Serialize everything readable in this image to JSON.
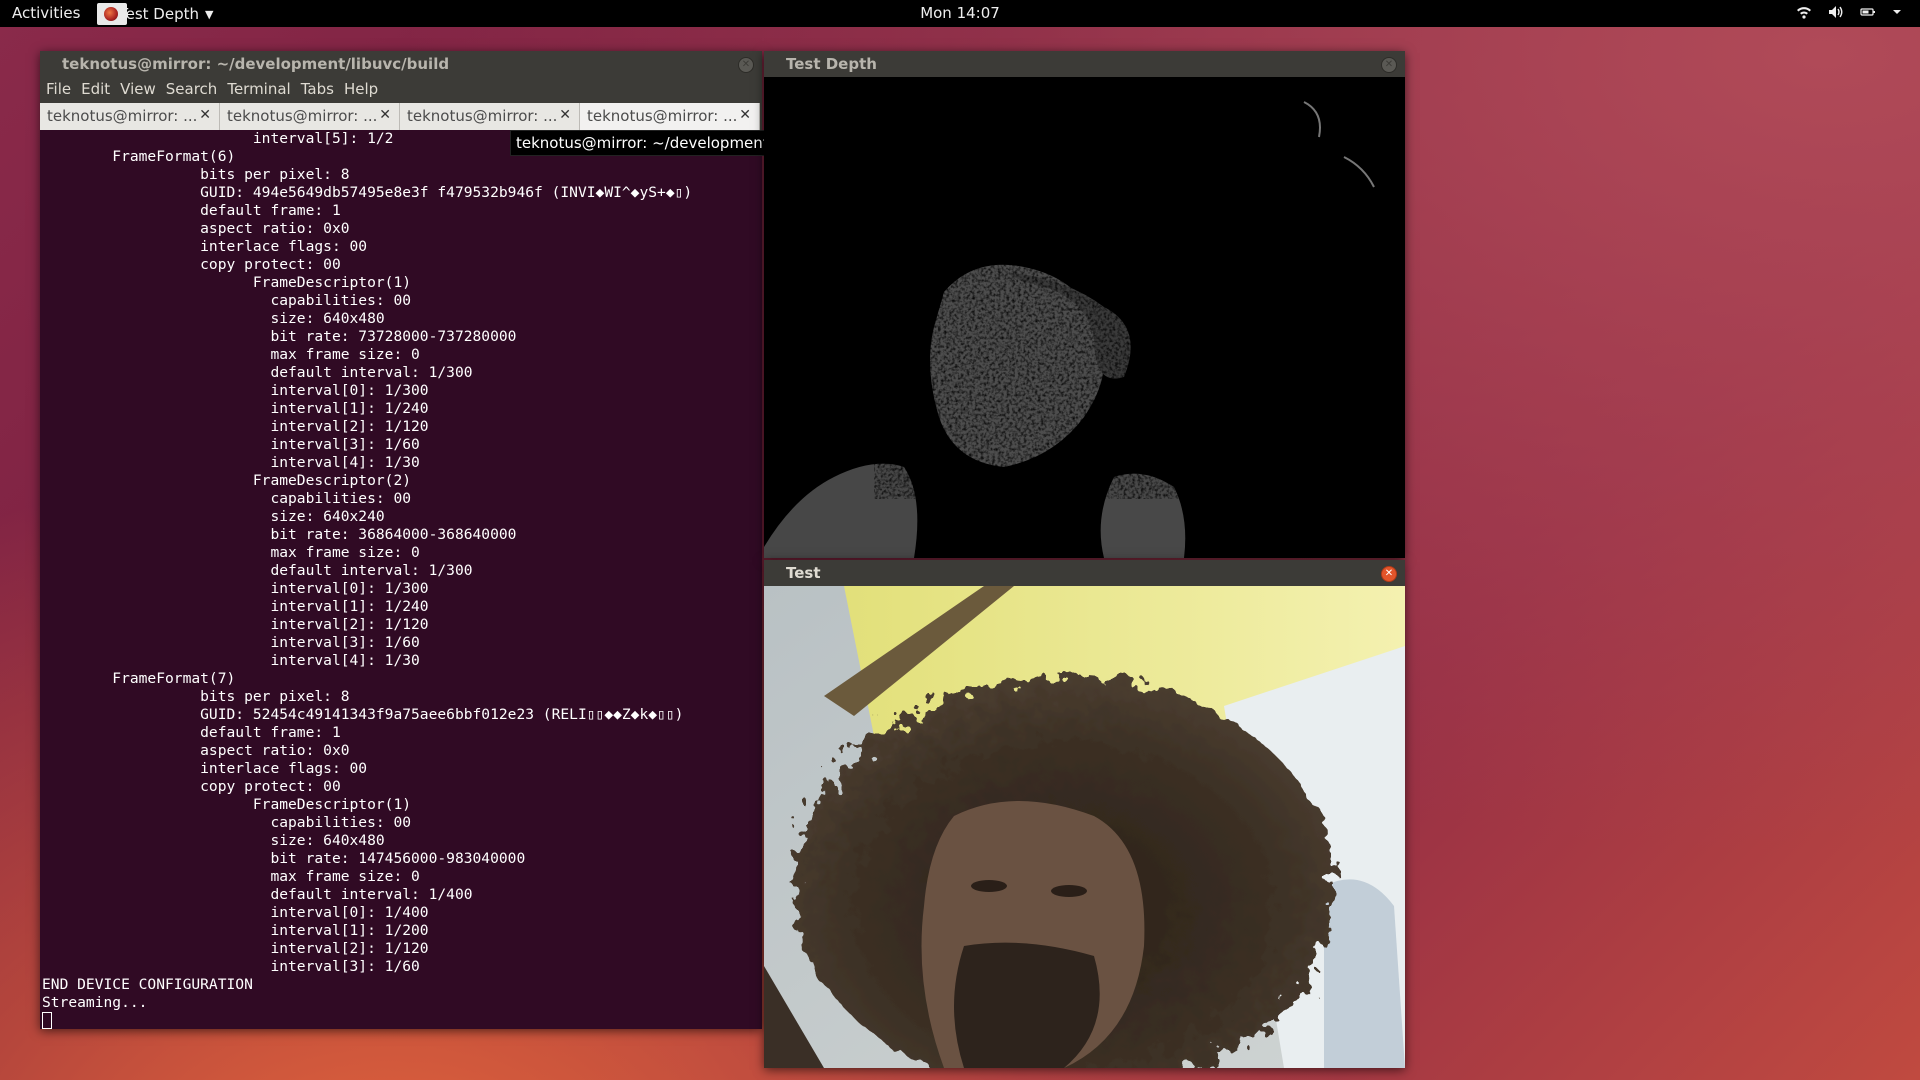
{
  "topbar": {
    "activities": "Activities",
    "app_name": "Test Depth",
    "clock": "Mon 14:07"
  },
  "terminal": {
    "title": "teknotus@mirror: ~/development/libuvc/build",
    "menu": [
      "File",
      "Edit",
      "View",
      "Search",
      "Terminal",
      "Tabs",
      "Help"
    ],
    "tabs": [
      {
        "label": "teknotus@mirror: ..."
      },
      {
        "label": "teknotus@mirror: ..."
      },
      {
        "label": "teknotus@mirror: ..."
      },
      {
        "label": "teknotus@mirror: ..."
      }
    ],
    "tooltip": "teknotus@mirror: ~/development/libuvc/build",
    "lines": [
      "                        interval[5]: 1/2",
      "        FrameFormat(6)",
      "                  bits per pixel: 8",
      "                  GUID: 494e5649db57495e8e3f f479532b946f (INVI◆WI^◆yS+◆▯)",
      "                  default frame: 1",
      "                  aspect ratio: 0x0",
      "                  interlace flags: 00",
      "                  copy protect: 00",
      "                        FrameDescriptor(1)",
      "                          capabilities: 00",
      "                          size: 640x480",
      "                          bit rate: 73728000-737280000",
      "                          max frame size: 0",
      "                          default interval: 1/300",
      "                          interval[0]: 1/300",
      "                          interval[1]: 1/240",
      "                          interval[2]: 1/120",
      "                          interval[3]: 1/60",
      "                          interval[4]: 1/30",
      "                        FrameDescriptor(2)",
      "                          capabilities: 00",
      "                          size: 640x240",
      "                          bit rate: 36864000-368640000",
      "                          max frame size: 0",
      "                          default interval: 1/300",
      "                          interval[0]: 1/300",
      "                          interval[1]: 1/240",
      "                          interval[2]: 1/120",
      "                          interval[3]: 1/60",
      "                          interval[4]: 1/30",
      "        FrameFormat(7)",
      "                  bits per pixel: 8",
      "                  GUID: 52454c49141343f9a75aee6bbf012e23 (RELI▯▯◆◆Z◆k◆▯▯)",
      "                  default frame: 1",
      "                  aspect ratio: 0x0",
      "                  interlace flags: 00",
      "                  copy protect: 00",
      "                        FrameDescriptor(1)",
      "                          capabilities: 00",
      "                          size: 640x480",
      "                          bit rate: 147456000-983040000",
      "                          max frame size: 0",
      "                          default interval: 1/400",
      "                          interval[0]: 1/400",
      "                          interval[1]: 1/200",
      "                          interval[2]: 1/120",
      "                          interval[3]: 1/60",
      "END DEVICE CONFIGURATION",
      "Streaming..."
    ]
  },
  "depth_window": {
    "title": "Test Depth"
  },
  "color_window": {
    "title": "Test"
  }
}
